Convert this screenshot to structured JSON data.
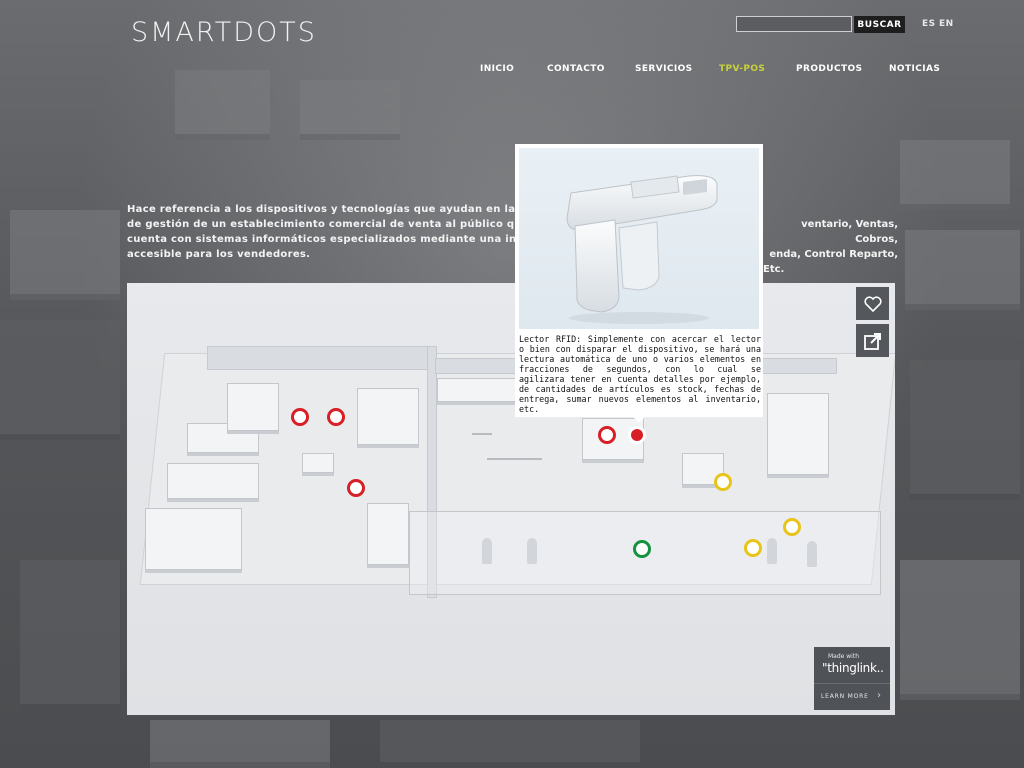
{
  "header": {
    "logo": "SMARTDOTS",
    "search": {
      "placeholder": "",
      "button_label": "BUSCAR"
    },
    "languages": [
      "ES",
      "EN"
    ]
  },
  "nav": {
    "items": [
      {
        "label": "INICIO",
        "active": false
      },
      {
        "label": "CONTACTO",
        "active": false
      },
      {
        "label": "SERVICIOS",
        "active": false
      },
      {
        "label": "TPV-POS",
        "active": true
      },
      {
        "label": "PRODUCTOS",
        "active": false
      },
      {
        "label": "NOTICIAS",
        "active": false
      }
    ],
    "active_color": "#c9d23a"
  },
  "intro": {
    "lines": [
      "Hace referencia a los dispositivos y tecnologías que ayudan en la tar",
      "de gestión de un establecimiento comercial de venta al público que",
      "cuenta con sistemas informáticos especializados mediante una interfa",
      "accesible para los vendedores."
    ],
    "right_lines": [
      "ventario, Ventas, Cobros,",
      "enda, Control Reparto,",
      "Etc."
    ]
  },
  "tooltip": {
    "text": "Lector RFID: Simplemente con acercar el lector o bien con disparar el dispositivo, se hará una lectura automática de uno o varios elementos en fracciones de segundos, con lo cual se agilizara tener en cuenta detalles por ejemplo, de cantidades de artículos es stock, fechas de entrega, sumar nuevos elementos al inventario, etc."
  },
  "hotspots": {
    "colors": {
      "red": "#d81f26",
      "yellow": "#e8c41a",
      "green": "#14923d"
    },
    "count": 9
  },
  "side_buttons": {
    "like_icon": "heart-icon",
    "share_icon": "share-icon"
  },
  "thinglink": {
    "made_with": "Made with",
    "brand": "\"thinglink..",
    "learn_more": "LEARN MORE",
    "chevron": "›"
  }
}
